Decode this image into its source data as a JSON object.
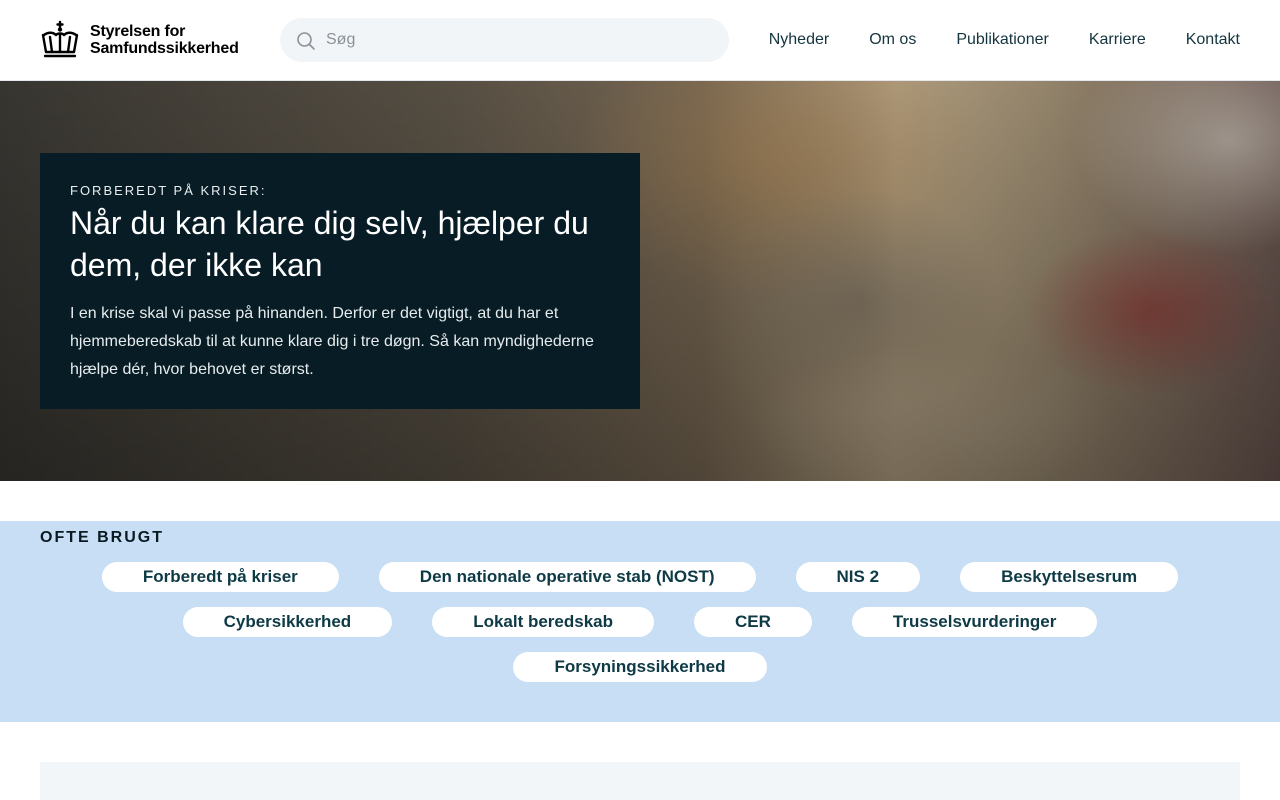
{
  "logo": {
    "line1": "Styrelsen for",
    "line2": "Samfundssikkerhed"
  },
  "search": {
    "placeholder": "Søg"
  },
  "nav": {
    "items": [
      "Nyheder",
      "Om os",
      "Publikationer",
      "Karriere",
      "Kontakt"
    ]
  },
  "hero": {
    "kicker": "FORBEREDT PÅ KRISER:",
    "title": "Når du kan klare dig selv, hjælper du dem, der ikke kan",
    "text": "I en krise skal vi passe på hinanden. Derfor er det vigtigt, at du har et hjemmeberedskab til at kunne klare dig i tre døgn. Så kan myndighederne hjælpe dér, hvor behovet er størst."
  },
  "often": {
    "title": "OFTE BRUGT",
    "rows": [
      [
        "Forberedt på kriser",
        "Den nationale operative stab (NOST)",
        "NIS 2",
        "Beskyttelsesrum"
      ],
      [
        "Cybersikkerhed",
        "Lokalt beredskab",
        "CER",
        "Trusselsvurderinger"
      ],
      [
        "Forsyningssikkerhed"
      ]
    ]
  },
  "colors": {
    "hero_box": "#071c24",
    "often_bg": "#c7def4",
    "pill_text": "#0e3a46",
    "nav_text": "#14353f"
  }
}
